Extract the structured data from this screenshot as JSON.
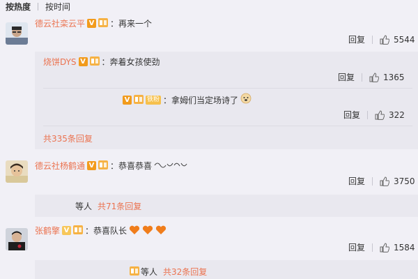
{
  "sort_tabs": {
    "hot": "按热度",
    "time": "按时间"
  },
  "comments": [
    {
      "name": "德云社栾云平",
      "text": "：再来一个",
      "reply_label": "回复",
      "likes": "5544",
      "replies": [
        {
          "name": "烧饼DYS",
          "text": "：奔着女孩使劲",
          "reply_label": "回复",
          "likes": "1365"
        },
        {
          "name": "",
          "text": "：拿姆们当定场诗了",
          "reply_label": "回复",
          "likes": "322"
        }
      ],
      "more": "共335条回复"
    },
    {
      "name": "德云社杨鹤通",
      "text": "：恭喜恭喜",
      "reply_label": "回复",
      "likes": "3750",
      "preview_text": "等人",
      "more": "共71条回复"
    },
    {
      "name": "张鹤擎",
      "text": "：恭喜队长",
      "reply_label": "回复",
      "likes": "1584",
      "preview_text": "等人",
      "more": "共32条回复"
    }
  ],
  "badge_v": "V",
  "badge_lv_small": "铁粉",
  "colors": {
    "name": "#eb7350",
    "verified": "#f29b1c",
    "heart": "#f07d1b",
    "background": "#f1f0f6"
  }
}
